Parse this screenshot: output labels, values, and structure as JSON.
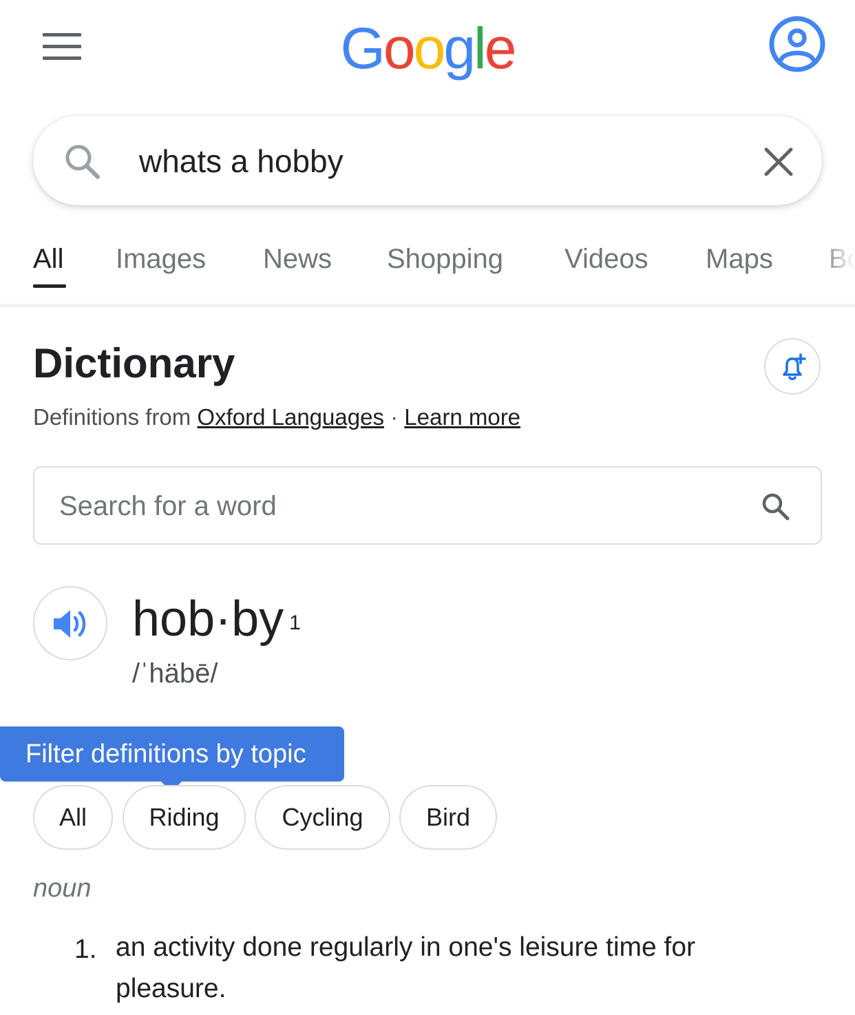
{
  "header": {
    "menu_icon": "hamburger-menu-icon",
    "logo": {
      "letters": [
        "G",
        "o",
        "o",
        "g",
        "l",
        "e"
      ],
      "colors": [
        "#4285f4",
        "#ea4335",
        "#fbbc05",
        "#4285f4",
        "#34a853",
        "#ea4335"
      ]
    },
    "account_icon": "account-circle-icon",
    "accent_color": "#4285f4"
  },
  "search": {
    "icon": "search-icon",
    "query": "whats a hobby",
    "clear_icon": "close-icon"
  },
  "tabs": [
    {
      "label": "All",
      "active": true
    },
    {
      "label": "Images",
      "active": false
    },
    {
      "label": "News",
      "active": false
    },
    {
      "label": "Shopping",
      "active": false
    },
    {
      "label": "Videos",
      "active": false
    },
    {
      "label": "Maps",
      "active": false
    },
    {
      "label": "Bo",
      "active": false
    }
  ],
  "dictionary": {
    "title": "Dictionary",
    "alert_icon": "bell-plus-icon",
    "source_prefix": "Definitions from ",
    "source_link": "Oxford Languages",
    "separator": " · ",
    "learn_more": "Learn more",
    "search_placeholder": "Search for a word",
    "search_icon": "search-icon",
    "speaker_icon": "speaker-icon",
    "headword": "hob·by",
    "headword_sup": "1",
    "phonetic": "/ˈhäbē/",
    "tooltip": "Filter definitions by topic",
    "tooltip_color": "#3f7ae0",
    "topics": [
      "All",
      "Riding",
      "Cycling",
      "Bird"
    ],
    "part_of_speech": "noun",
    "definitions": [
      {
        "number": "1.",
        "text": "an activity done regularly in one's leisure time for pleasure."
      }
    ]
  }
}
